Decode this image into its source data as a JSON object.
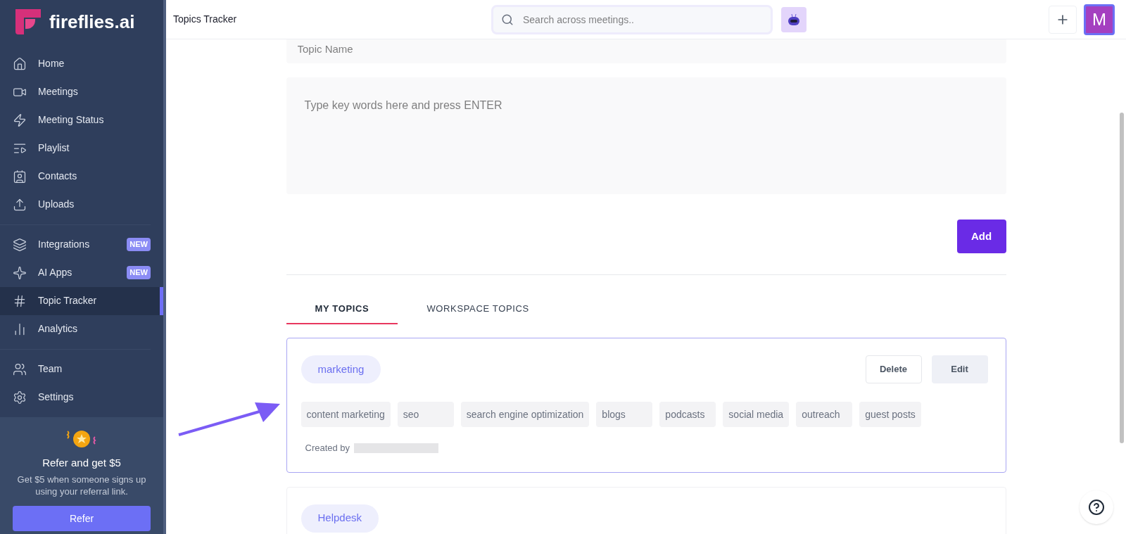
{
  "brand": {
    "name": "fireflies.ai"
  },
  "sidebar": {
    "groups": [
      {
        "items": [
          {
            "label": "Home",
            "selected": false
          },
          {
            "label": "Meetings",
            "selected": false
          },
          {
            "label": "Meeting Status",
            "selected": false
          },
          {
            "label": "Playlist",
            "selected": false
          },
          {
            "label": "Contacts",
            "selected": false
          },
          {
            "label": "Uploads",
            "selected": false
          }
        ]
      },
      {
        "items": [
          {
            "label": "Integrations",
            "selected": false,
            "badge": "NEW"
          },
          {
            "label": "AI Apps",
            "selected": false,
            "badge": "NEW"
          },
          {
            "label": "Topic Tracker",
            "selected": true
          },
          {
            "label": "Analytics",
            "selected": false
          }
        ]
      },
      {
        "items": [
          {
            "label": "Team",
            "selected": false
          },
          {
            "label": "Settings",
            "selected": false
          }
        ]
      }
    ]
  },
  "referral": {
    "title": "Refer and get $5",
    "text": "Get $5 when someone signs up using your referral link.",
    "button": "Refer"
  },
  "topbar": {
    "title": "Topics Tracker",
    "search_placeholder": "Search across meetings..",
    "avatar": "M"
  },
  "form": {
    "topic_placeholder": "Topic Name",
    "keywords_placeholder": "Type key words here and press ENTER",
    "add_button": "Add"
  },
  "tabs": [
    {
      "label": "MY TOPICS",
      "selected": true
    },
    {
      "label": "WORKSPACE TOPICS",
      "selected": false
    }
  ],
  "topics": [
    {
      "name": "marketing",
      "highlighted": true,
      "actions": [
        "Delete",
        "Edit"
      ],
      "keywords": [
        "content marketing",
        "seo",
        "search engine optimization",
        "blogs",
        "podcasts",
        "social media",
        "outreach",
        "guest posts"
      ],
      "created_by": "Created by"
    },
    {
      "name": "Helpdesk",
      "highlighted": false
    }
  ]
}
